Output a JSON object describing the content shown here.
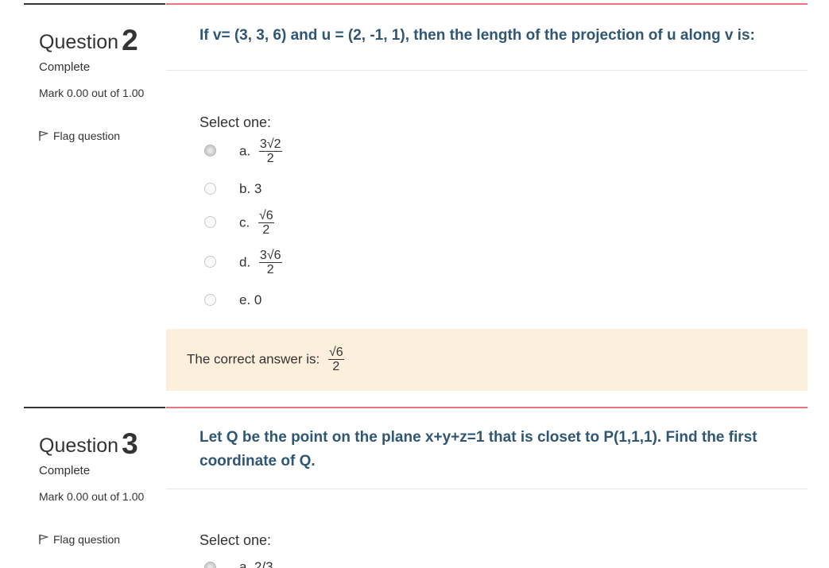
{
  "question2": {
    "label": "Question",
    "number": "2",
    "state": "Complete",
    "grade": "Mark 0.00 out of 1.00",
    "flag": "Flag question",
    "text": "If v= (3, 3, 6) and u = (2, -1, 1), then the length of the projection of u along v is:",
    "prompt": "Select one:",
    "options": [
      {
        "prefix": "a.",
        "num": "3√2",
        "den": "2",
        "checked": true
      },
      {
        "prefix": "b. 3"
      },
      {
        "prefix": "c.",
        "num": "√6",
        "den": "2"
      },
      {
        "prefix": "d.",
        "num": "3√6",
        "den": "2"
      },
      {
        "prefix": "e. 0"
      }
    ],
    "feedback_label": "The correct answer is:",
    "feedback_num": "√6",
    "feedback_den": "2"
  },
  "question3": {
    "label": "Question",
    "number": "3",
    "state": "Complete",
    "grade": "Mark 0.00 out of 1.00",
    "flag": "Flag question",
    "text": "Let Q be the point on the plane x+y+z=1 that is closet to P(1,1,1). Find the first coordinate of Q.",
    "prompt": "Select one:",
    "option_a_partial": "a. 2/3"
  },
  "colors": {
    "content_border": "#e8747f",
    "question_text": "#2f5673",
    "feedback_bg": "#fcefdc"
  }
}
